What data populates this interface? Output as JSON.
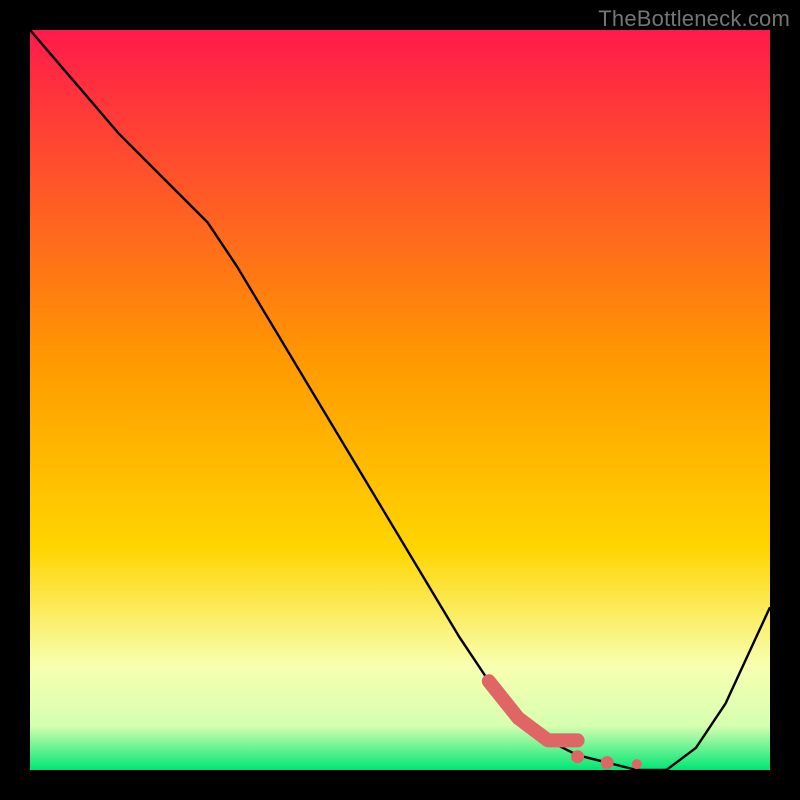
{
  "watermark": "TheBottleneck.com",
  "colors": {
    "gradient_top": "#ff1a4b",
    "gradient_mid": "#ffd500",
    "gradient_lowlight": "#f8ffb0",
    "gradient_green": "#00e676",
    "line": "#000000",
    "marker": "#e06666",
    "frame": "#000000"
  },
  "chart_data": {
    "type": "line",
    "title": "",
    "xlabel": "",
    "ylabel": "",
    "xlim": [
      0,
      100
    ],
    "ylim": [
      0,
      100
    ],
    "series": [
      {
        "name": "bottleneck-curve",
        "x": [
          0,
          6,
          12,
          18,
          24,
          28,
          34,
          40,
          46,
          52,
          58,
          62,
          66,
          70,
          74,
          78,
          82,
          86,
          90,
          94,
          100
        ],
        "values": [
          100,
          93,
          86,
          80,
          74,
          68,
          58,
          48,
          38,
          28,
          18,
          12,
          7,
          4,
          2,
          1,
          0,
          0,
          3,
          9,
          22
        ]
      }
    ],
    "markers": {
      "name": "highlight-trough",
      "x": [
        62,
        66,
        70,
        74,
        78,
        82
      ],
      "values": [
        12,
        7,
        4,
        1.8,
        1,
        0.8
      ]
    }
  }
}
